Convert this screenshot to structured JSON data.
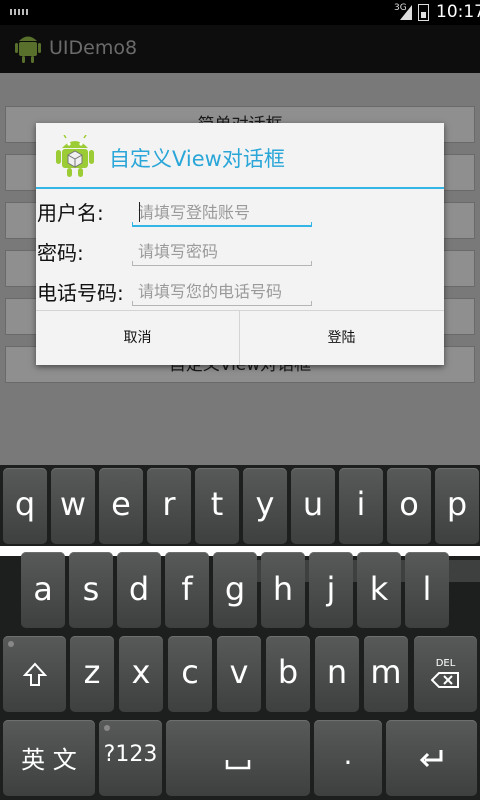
{
  "status_bar": {
    "network": "3G",
    "time": "10:17"
  },
  "action_bar": {
    "title": "UIDemo8",
    "icon": "android-robot-icon"
  },
  "background_buttons": [
    "简单对话框",
    "",
    "",
    "",
    "",
    "自定义View对话框"
  ],
  "dialog": {
    "title": "自定义View对话框",
    "icon": "android-robot-icon",
    "fields": [
      {
        "label": "用户名:",
        "placeholder": "请填写登陆账号",
        "value": ""
      },
      {
        "label": "密码:",
        "placeholder": "请填写密码",
        "value": ""
      },
      {
        "label": "电话号码:",
        "placeholder": "请填写您的电话号码",
        "value": ""
      }
    ],
    "cancel_label": "取消",
    "login_label": "登陆",
    "accent_color": "#33b5e5"
  },
  "keyboard": {
    "row1": [
      "q",
      "w",
      "e",
      "r",
      "t",
      "y",
      "u",
      "i",
      "o",
      "p"
    ],
    "row2": [
      "a",
      "s",
      "d",
      "f",
      "g",
      "h",
      "j",
      "k",
      "l"
    ],
    "row3": [
      "z",
      "x",
      "c",
      "v",
      "b",
      "n",
      "m"
    ],
    "shift_icon": "shift-icon",
    "delete_label": "DEL",
    "lang_label": "英 文",
    "symbols_label": "?123",
    "space_icon": "space-icon",
    "period_label": ".",
    "enter_icon": "enter-icon"
  }
}
